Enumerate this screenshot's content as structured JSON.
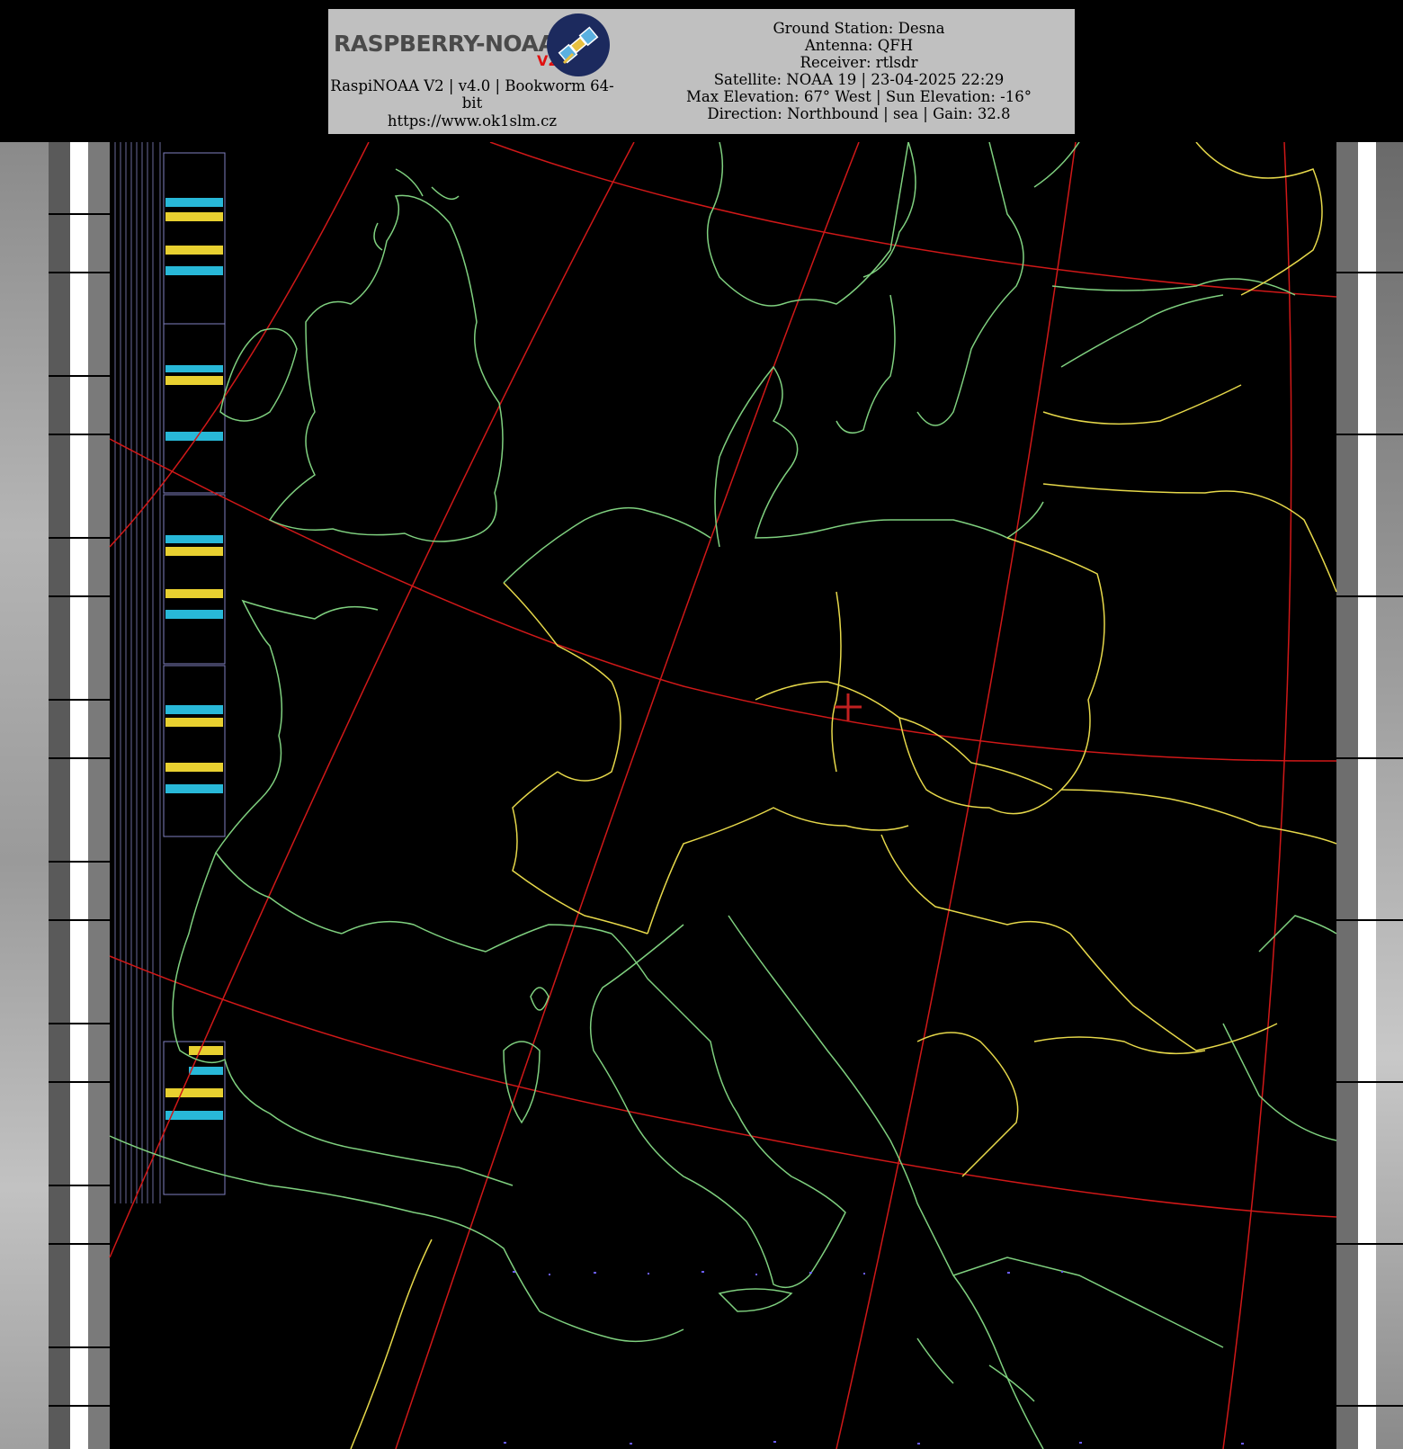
{
  "header": {
    "logo_text": "RASPBERRY-NOAA",
    "logo_badge": "V2",
    "version_line": "RaspiNOAA V2 | v4.0 | Bookworm 64-bit",
    "website": "https://www.ok1slm.cz",
    "ground_station": "Ground Station: Desna",
    "antenna": "Antenna: QFH",
    "receiver": "Receiver: rtlsdr",
    "satellite_line": "Satellite: NOAA 19 | 23-04-2025 22:29",
    "elevation_line": "Max Elevation: 67° West | Sun Elevation: -16°",
    "direction_line": "Direction: Northbound | sea | Gain: 32.8"
  },
  "map": {
    "icons": [
      "satellite-icon",
      "ground-station-marker-icon"
    ],
    "colors": {
      "background": "#000000",
      "coastline": "#7fd07f",
      "borders": "#e6d84a",
      "graticule": "#d01818",
      "station_marker": "#c02020",
      "header_bg": "#c0c0c0"
    }
  }
}
